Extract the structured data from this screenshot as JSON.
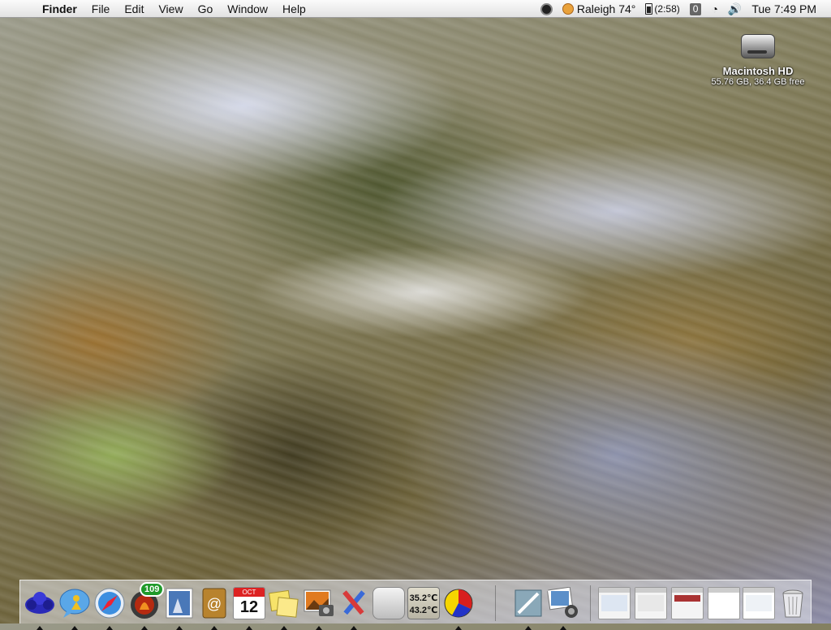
{
  "menubar": {
    "apple_glyph": "",
    "app_name": "Finder",
    "menus": [
      "File",
      "Edit",
      "View",
      "Go",
      "Window",
      "Help"
    ],
    "weather": "Raleigh 74°",
    "battery": "(2:58)",
    "counter": "0",
    "clock": "Tue 7:49 PM",
    "volume_glyph": "🔊",
    "wifi_glyph": "◔"
  },
  "desktop": {
    "drive_name": "Macintosh HD",
    "drive_info": "55.76 GB, 36.4 GB free"
  },
  "dock": {
    "mail_badge": "109",
    "calendar_month": "OCT",
    "calendar_day": "12",
    "temp_cpu": "35.2℃",
    "temp_gpu": "43.2℃",
    "apple_glyph": ""
  },
  "colors": {
    "badge": "#1f9a2a",
    "apple_blue": "#2d5fb3"
  },
  "icons": [
    "apple-menu-icon",
    "weather-icon",
    "battery-icon",
    "wifi-icon",
    "volume-icon",
    "finder-icon",
    "ichat-icon",
    "safari-icon",
    "mail-icon",
    "photo-icon",
    "addressbook-icon",
    "ical-icon",
    "stickies-icon",
    "iphoto-icon",
    "pencil-icon",
    "apple-app-icon",
    "temperature-monitor-icon",
    "disk-usage-icon",
    "preview-icon",
    "image-capture-icon",
    "minimized-window-icon",
    "trash-icon"
  ]
}
